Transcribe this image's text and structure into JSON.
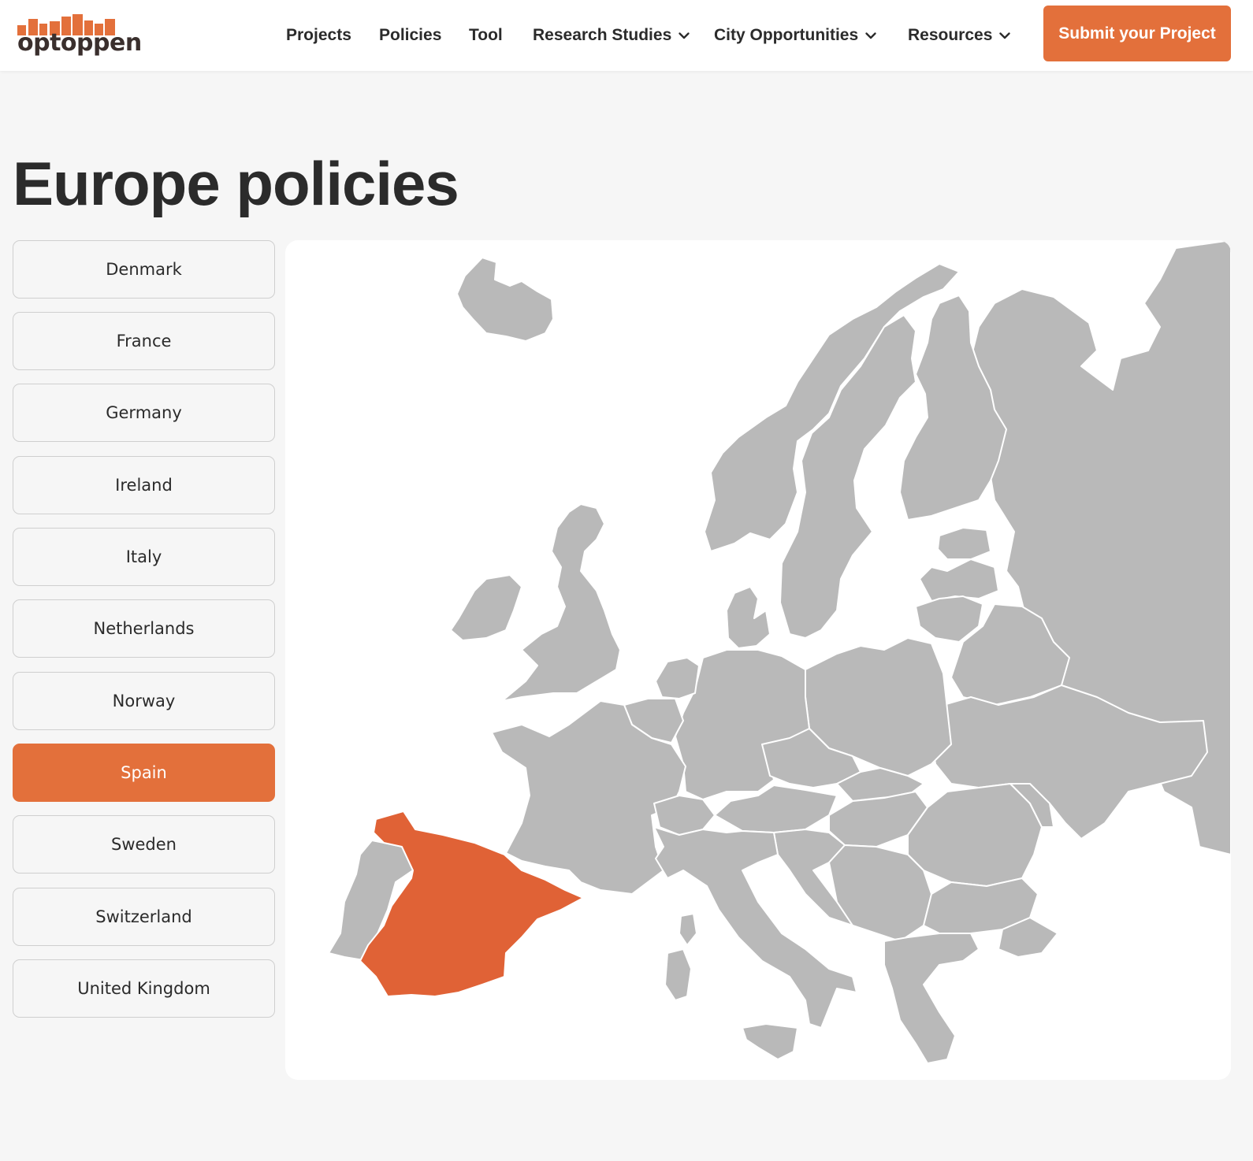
{
  "brand": {
    "logo_text": "optoppen",
    "logo_color": "#e3703b",
    "text_color": "#3a2f2d"
  },
  "nav": {
    "items": [
      {
        "label": "Projects",
        "has_dropdown": false
      },
      {
        "label": "Policies",
        "has_dropdown": false
      },
      {
        "label": "Tool",
        "has_dropdown": false
      },
      {
        "label": "Research Studies",
        "has_dropdown": true
      },
      {
        "label": "City Opportunities",
        "has_dropdown": true
      },
      {
        "label": "Resources",
        "has_dropdown": true
      }
    ],
    "dropdown_icon": "chevron-down-icon",
    "cta_label": "Submit your Project"
  },
  "page": {
    "title": "Europe policies"
  },
  "countries": {
    "selected": "Spain",
    "items": [
      "Denmark",
      "France",
      "Germany",
      "Ireland",
      "Italy",
      "Netherlands",
      "Norway",
      "Spain",
      "Sweden",
      "Switzerland",
      "United Kingdom"
    ]
  },
  "colors": {
    "accent": "#e3703b",
    "map_highlight": "#e06236",
    "map_land": "#b9b9b9",
    "page_bg": "#f6f6f6"
  }
}
